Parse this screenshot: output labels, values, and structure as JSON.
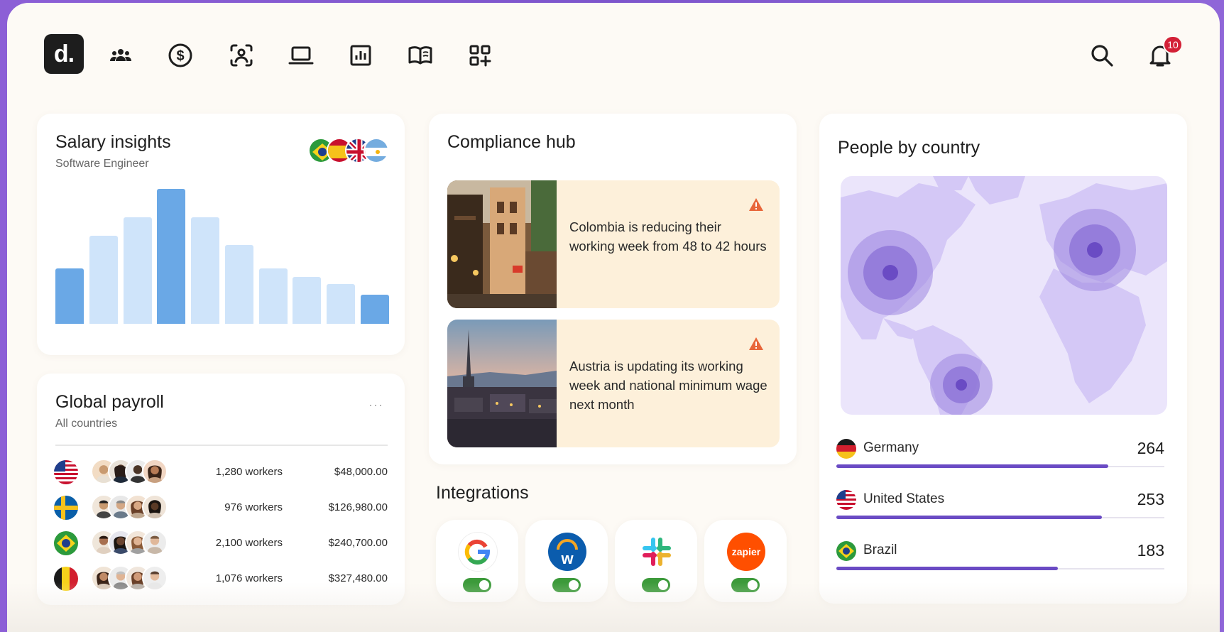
{
  "nav": {
    "logo_text": "d.",
    "icons": [
      "people-icon",
      "dollar-icon",
      "person-scan-icon",
      "laptop-icon",
      "chart-icon",
      "book-icon",
      "add-app-icon"
    ],
    "notification_count": "10"
  },
  "salary": {
    "title": "Salary insights",
    "subtitle": "Software Engineer",
    "flags": [
      "Brazil",
      "Spain",
      "United Kingdom",
      "Argentina"
    ],
    "chart_data": {
      "type": "bar",
      "categories": [
        "",
        "",
        "",
        "",
        "",
        "",
        "",
        "",
        "",
        ""
      ],
      "values": [
        38,
        60,
        73,
        92,
        73,
        54,
        38,
        32,
        27,
        20
      ],
      "highlighted": [
        0,
        3,
        9
      ],
      "colors": {
        "highlight": "#6aa8e6",
        "normal": "#cfe4fa"
      }
    }
  },
  "compliance": {
    "title": "Compliance hub",
    "alerts": [
      {
        "text": "Colombia is reducing their working week from 48 to 42 hours"
      },
      {
        "text": "Austria is updating its working week and national minimum wage next month"
      }
    ]
  },
  "payroll": {
    "title": "Global payroll",
    "subtitle": "All countries",
    "menu": "···",
    "rows": [
      {
        "country": "United States",
        "workers": "1,280 workers",
        "amount": "$48,000.00"
      },
      {
        "country": "Sweden",
        "workers": "976 workers",
        "amount": "$126,980.00"
      },
      {
        "country": "Brazil",
        "workers": "2,100 workers",
        "amount": "$240,700.00"
      },
      {
        "country": "Belgium",
        "workers": "1,076 workers",
        "amount": "$327,480.00"
      }
    ]
  },
  "integrations": {
    "title": "Integrations",
    "items": [
      {
        "name": "google",
        "enabled": true
      },
      {
        "name": "workday",
        "label": "w",
        "enabled": true
      },
      {
        "name": "slack",
        "enabled": true
      },
      {
        "name": "zapier",
        "label": "zapier",
        "enabled": true
      }
    ]
  },
  "people": {
    "title": "People by country",
    "rows": [
      {
        "country": "Germany",
        "count": "264",
        "fill": 0.83
      },
      {
        "country": "United States",
        "count": "253",
        "fill": 0.81
      },
      {
        "country": "Brazil",
        "count": "183",
        "fill": 0.675
      }
    ]
  }
}
